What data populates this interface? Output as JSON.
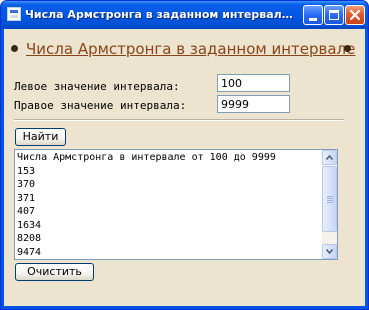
{
  "window": {
    "title": "Числа Армстронга в заданном интервале - Micros..."
  },
  "heading": "Числа Армстронга в заданном интервале",
  "form": {
    "left_label": "Левое значение интервала:",
    "left_value": "100",
    "right_label": "Правое значение интервала:",
    "right_value": "9999"
  },
  "buttons": {
    "find": "Найти",
    "clear": "Очистить"
  },
  "results": {
    "lines": [
      "Числа Армстронга в интервале от 100 до 9999",
      "153",
      "370",
      "371",
      "407",
      "1634",
      "8208",
      "9474"
    ]
  },
  "icons": {
    "app": "document-icon",
    "minimize": "minimize-icon",
    "maximize": "maximize-icon",
    "close": "close-icon",
    "scroll_up": "chevron-up-icon",
    "scroll_down": "chevron-down-icon"
  },
  "colors": {
    "titlebar": "#0058e6",
    "client_background": "#ece4cf",
    "heading_link": "#8a4418",
    "close_button": "#e05a2a"
  }
}
